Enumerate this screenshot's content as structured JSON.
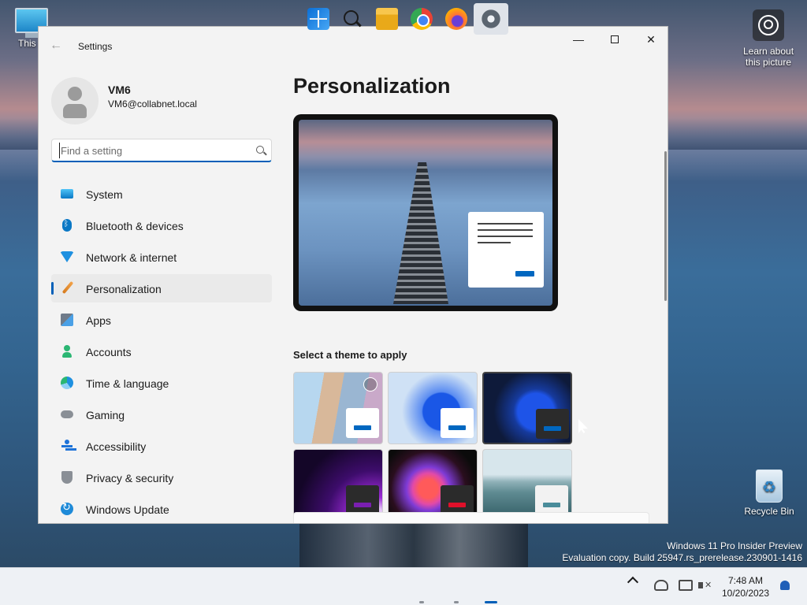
{
  "desktop": {
    "this_pc_label": "This P",
    "recycle_bin_label": "Recycle Bin",
    "learn_label_1": "Learn about",
    "learn_label_2": "this picture",
    "watermark_line1": "Windows 11 Pro Insider Preview",
    "watermark_line2": "Evaluation copy. Build 25947.rs_prerelease.230901-1416"
  },
  "window": {
    "title": "Settings",
    "back_glyph": "←",
    "minimize_glyph": "—",
    "close_glyph": "✕"
  },
  "profile": {
    "name": "VM6",
    "email": "VM6@collabnet.local"
  },
  "search": {
    "placeholder": "Find a setting",
    "value": ""
  },
  "sidebar": {
    "items": [
      {
        "label": "System",
        "icon": "system-icon"
      },
      {
        "label": "Bluetooth & devices",
        "icon": "bluetooth-icon"
      },
      {
        "label": "Network & internet",
        "icon": "wifi-icon"
      },
      {
        "label": "Personalization",
        "icon": "brush-icon",
        "selected": true
      },
      {
        "label": "Apps",
        "icon": "apps-icon"
      },
      {
        "label": "Accounts",
        "icon": "person-icon"
      },
      {
        "label": "Time & language",
        "icon": "globe-clock-icon"
      },
      {
        "label": "Gaming",
        "icon": "gamepad-icon"
      },
      {
        "label": "Accessibility",
        "icon": "accessibility-icon"
      },
      {
        "label": "Privacy & security",
        "icon": "shield-icon"
      },
      {
        "label": "Windows Update",
        "icon": "update-icon"
      }
    ]
  },
  "main": {
    "title": "Personalization",
    "themes_label": "Select a theme to apply",
    "themes": [
      {
        "name": "theme-spotlight",
        "bar_color": "#0067c0",
        "window_color": "#ffffff",
        "selected": false
      },
      {
        "name": "theme-windows-light",
        "bar_color": "#0067c0",
        "window_color": "#ffffff",
        "selected": false
      },
      {
        "name": "theme-windows-dark",
        "bar_color": "#0067c0",
        "window_color": "#2b2b2b",
        "selected": true
      },
      {
        "name": "theme-glow",
        "bar_color": "#7a1fb0",
        "window_color": "#2b2b2b",
        "selected": false
      },
      {
        "name": "theme-captured-motion",
        "bar_color": "#e0102a",
        "window_color": "#2b2b2b",
        "selected": false
      },
      {
        "name": "theme-sunrise",
        "bar_color": "#4a8c9a",
        "window_color": "#f2f2f2",
        "selected": false
      }
    ]
  },
  "taskbar": {
    "clock_time": "7:48 AM",
    "clock_date": "10/20/2023"
  },
  "colors": {
    "accent": "#005fb8"
  }
}
